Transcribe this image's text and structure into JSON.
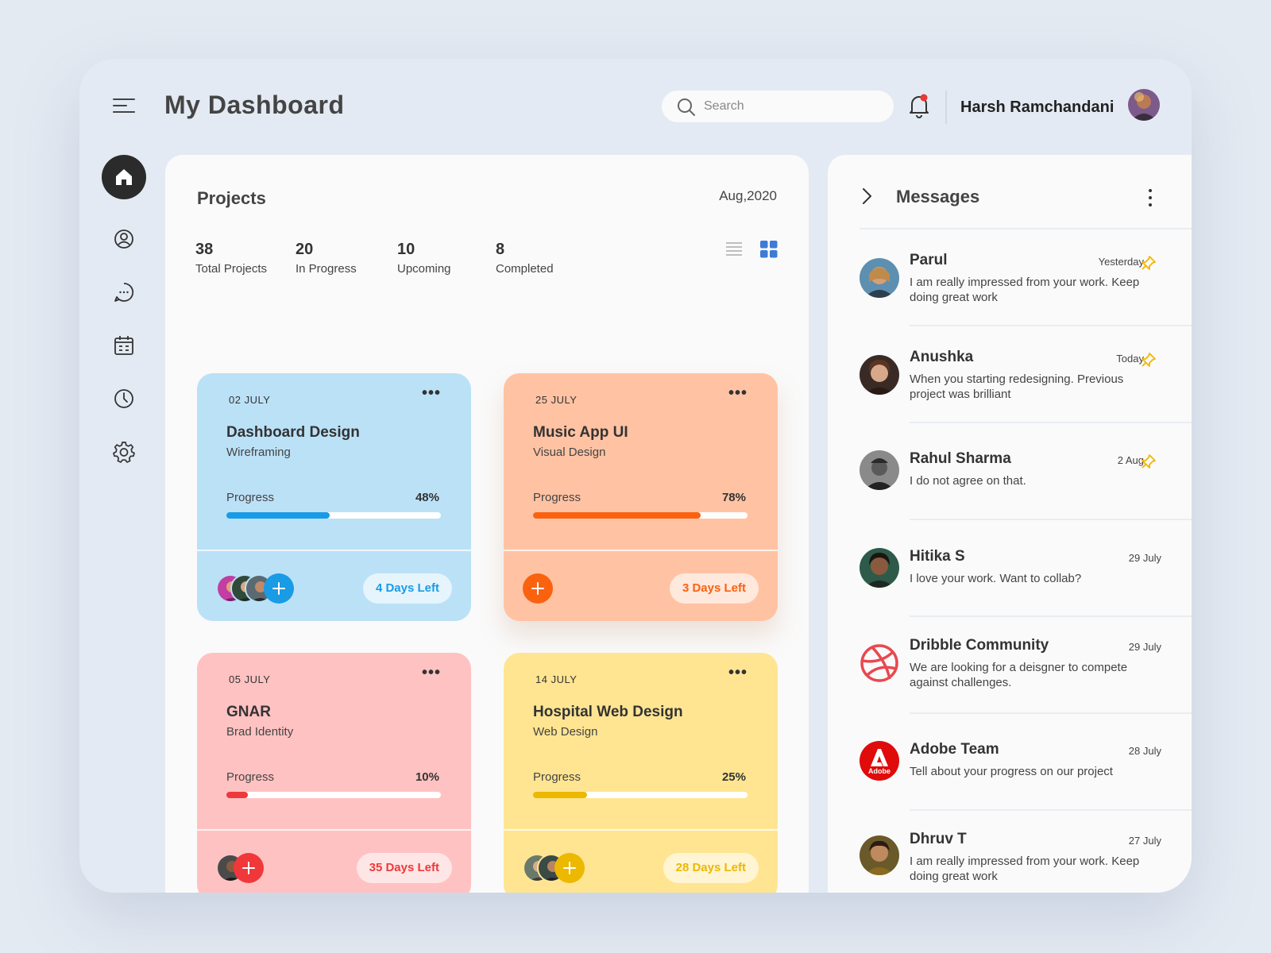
{
  "header": {
    "title": "My Dashboard",
    "search_placeholder": "Search",
    "user_name": "Harsh Ramchandani",
    "icons": [
      "menu-icon",
      "search-icon",
      "bell-icon"
    ]
  },
  "sidebar": {
    "items": [
      "home-icon",
      "profile-icon",
      "chat-icon",
      "calendar-icon",
      "clock-icon",
      "settings-icon"
    ]
  },
  "projects": {
    "title": "Projects",
    "date": "Aug,2020",
    "stats": [
      {
        "num": "38",
        "label": "Total Projects"
      },
      {
        "num": "20",
        "label": "In Progress"
      },
      {
        "num": "10",
        "label": "Upcoming"
      },
      {
        "num": "8",
        "label": "Completed"
      }
    ],
    "progress_label": "Progress",
    "cards": [
      {
        "date": "02 JULY",
        "title": "Dashboard Design",
        "subtitle": "Wireframing",
        "progress": 48,
        "progress_text": "48%",
        "days": "4 Days Left",
        "bg": "#bbe1f7",
        "accent": "#1a9be6",
        "pill_bg": "#e6f4fc"
      },
      {
        "date": "25 JULY",
        "title": "Music App UI",
        "subtitle": "Visual Design",
        "progress": 78,
        "progress_text": "78%",
        "days": "3 Days Left",
        "bg": "#ffc3a3",
        "accent": "#fa6210",
        "pill_bg": "#ffe8dc"
      },
      {
        "date": "05 JULY",
        "title": "GNAR",
        "subtitle": "Brad Identity",
        "progress": 10,
        "progress_text": "10%",
        "days": "35 Days Left",
        "bg": "#ffc2c2",
        "accent": "#f0383a",
        "pill_bg": "#ffe6e6"
      },
      {
        "date": "14 JULY",
        "title": "Hospital Web Design",
        "subtitle": "Web Design",
        "progress": 25,
        "progress_text": "25%",
        "days": "28 Days Left",
        "bg": "#ffe592",
        "accent": "#ecb800",
        "pill_bg": "#fff5d3"
      }
    ]
  },
  "messages": {
    "title": "Messages",
    "items": [
      {
        "name": "Parul",
        "time": "Yesterday",
        "text": "I am really impressed from your work. Keep doing great work",
        "pinned": true
      },
      {
        "name": "Anushka",
        "time": "Today",
        "text": "When you starting redesigning. Previous project was brilliant",
        "pinned": true
      },
      {
        "name": "Rahul Sharma",
        "time": "2 Aug",
        "text": "I do not agree on that.",
        "pinned": true
      },
      {
        "name": "Hitika S",
        "time": "29 July",
        "text": "I love your work. Want to collab?",
        "pinned": false
      },
      {
        "name": "Dribble Community",
        "time": "29 July",
        "text": "We are looking for a deisgner to compete against challenges.",
        "pinned": false
      },
      {
        "name": "Adobe Team",
        "time": "28 July",
        "text": "Tell about your progress on our project",
        "pinned": false
      },
      {
        "name": "Dhruv T",
        "time": "27 July",
        "text": "I am really impressed from your work. Keep doing great work",
        "pinned": false
      }
    ],
    "adobe_logo_text": "Adobe"
  },
  "colors": {
    "pin": "#f2b600",
    "grid_active": "#3d7bd6"
  }
}
